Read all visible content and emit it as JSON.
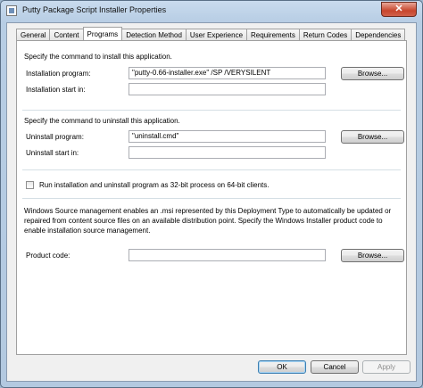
{
  "window": {
    "title": "Putty Package Script Installer Properties",
    "close_glyph": "✕"
  },
  "tabs": [
    {
      "label": "General"
    },
    {
      "label": "Content"
    },
    {
      "label": "Programs"
    },
    {
      "label": "Detection Method"
    },
    {
      "label": "User Experience"
    },
    {
      "label": "Requirements"
    },
    {
      "label": "Return Codes"
    },
    {
      "label": "Dependencies"
    }
  ],
  "active_tab": "Programs",
  "install": {
    "heading": "Specify the command to install this application.",
    "program_label": "Installation program:",
    "program_value": "\"putty-0.66-installer.exe\" /SP /VERYSILENT",
    "start_label": "Installation start in:",
    "start_value": "",
    "browse_label": "Browse..."
  },
  "uninstall": {
    "heading": "Specify the command to uninstall this application.",
    "program_label": "Uninstall program:",
    "program_value": "\"uninstall.cmd\"",
    "start_label": "Uninstall start in:",
    "start_value": "",
    "browse_label": "Browse..."
  },
  "run32": {
    "label": "Run installation and uninstall program as 32-bit process on 64-bit clients.",
    "checked": false
  },
  "wsm": {
    "description": "Windows Source management enables an .msi represented by this Deployment Type to automatically be updated or repaired from content source files on an available distribution point. Specify the Windows Installer product code to enable installation source management.",
    "product_label": "Product code:",
    "product_value": "",
    "browse_label": "Browse..."
  },
  "footer": {
    "ok": "OK",
    "cancel": "Cancel",
    "apply": "Apply"
  }
}
